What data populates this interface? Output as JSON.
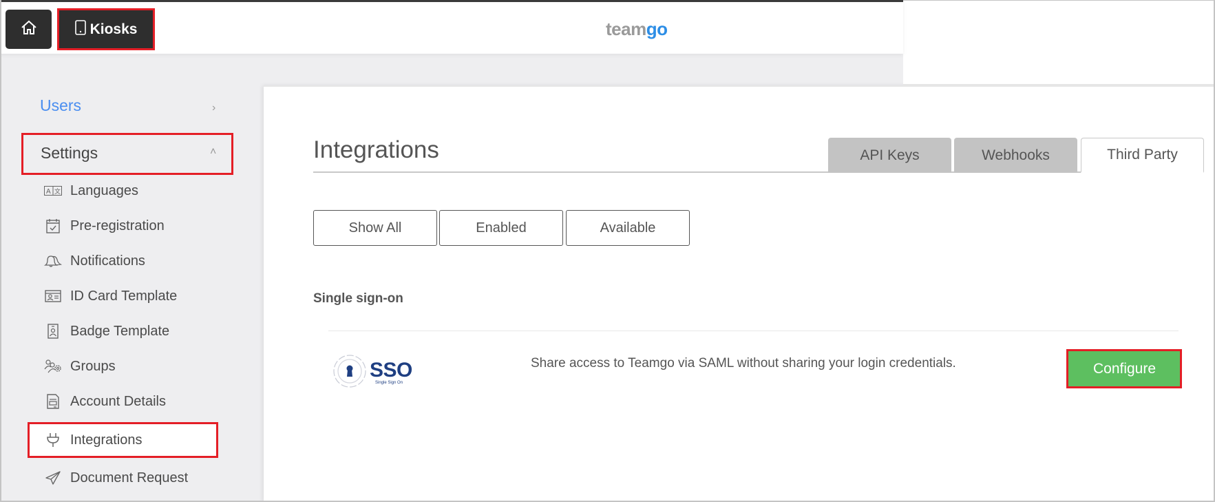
{
  "header": {
    "home_icon": "home-icon",
    "kiosks_label": "Kiosks",
    "kiosks_icon": "tablet-icon",
    "logo_part1": "team",
    "logo_part2": "go"
  },
  "sidebar": {
    "users_label": "Users",
    "settings_label": "Settings",
    "items": [
      {
        "label": "Languages",
        "icon": "language-icon"
      },
      {
        "label": "Pre-registration",
        "icon": "calendar-check-icon"
      },
      {
        "label": "Notifications",
        "icon": "bell-icon"
      },
      {
        "label": "ID Card Template",
        "icon": "id-card-icon"
      },
      {
        "label": "Badge Template",
        "icon": "badge-icon"
      },
      {
        "label": "Groups",
        "icon": "groups-icon"
      },
      {
        "label": "Account Details",
        "icon": "document-icon"
      },
      {
        "label": "Integrations",
        "icon": "plug-icon"
      },
      {
        "label": "Document Request",
        "icon": "send-icon"
      }
    ]
  },
  "main": {
    "title": "Integrations",
    "tabs": [
      {
        "label": "API Keys",
        "active": false
      },
      {
        "label": "Webhooks",
        "active": false
      },
      {
        "label": "Third Party",
        "active": true
      }
    ],
    "filters": [
      {
        "label": "Show All"
      },
      {
        "label": "Enabled"
      },
      {
        "label": "Available"
      }
    ],
    "section_title": "Single sign-on",
    "integration": {
      "logo_text": "SSO",
      "logo_subtext": "Single Sign On",
      "description": "Share access to Teamgo via SAML without sharing your login credentials.",
      "configure_label": "Configure"
    }
  },
  "colors": {
    "accent_blue": "#4a8ef0",
    "configure_green": "#5dbf60",
    "highlight_red": "#e41e26",
    "header_dark": "#2e2e2e"
  }
}
